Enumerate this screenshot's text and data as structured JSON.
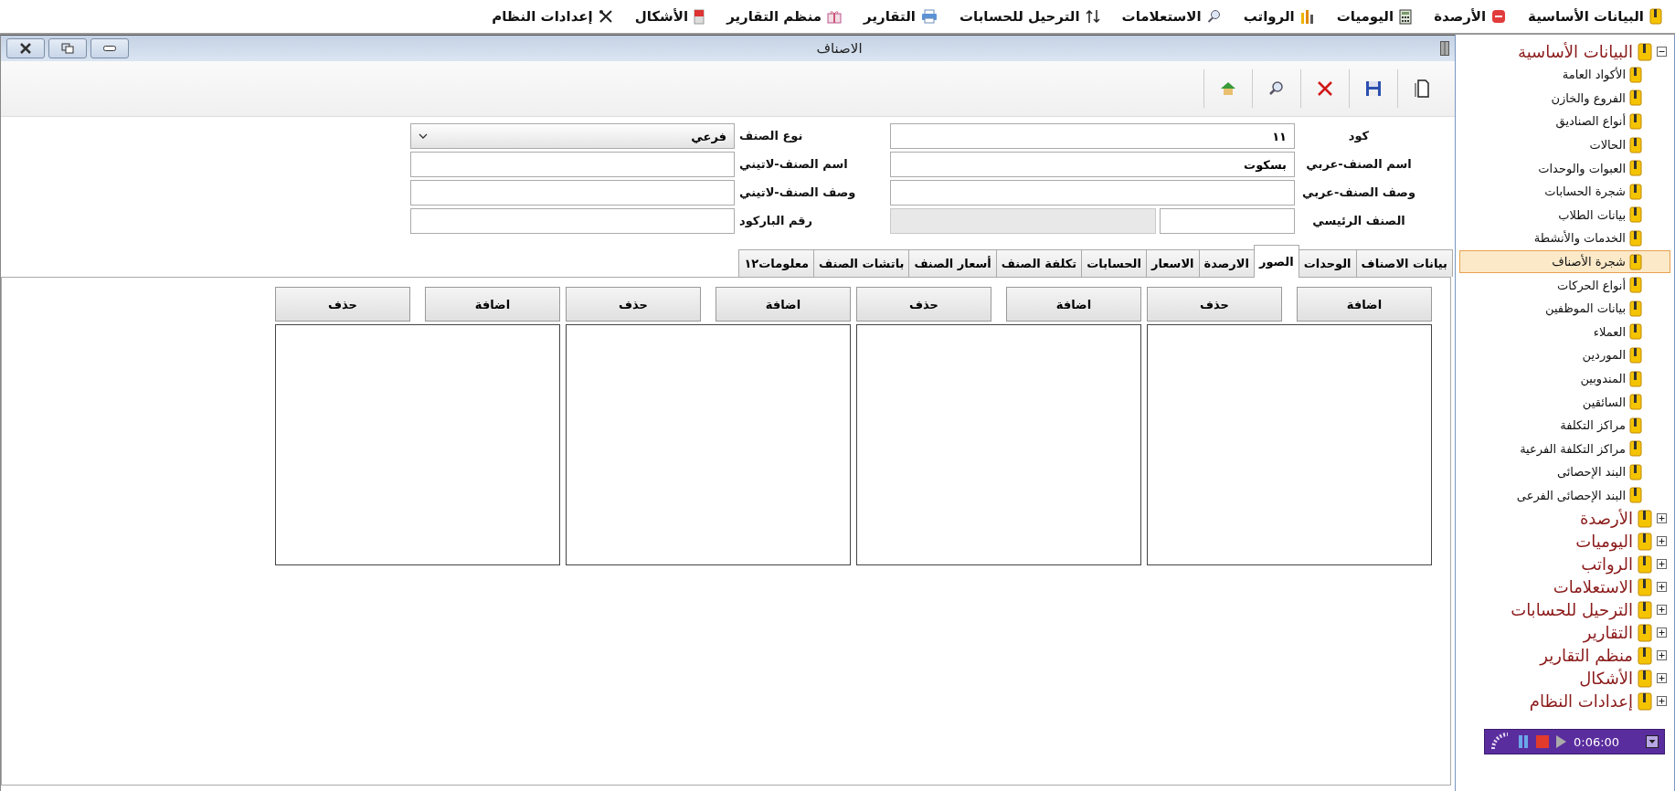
{
  "menu": [
    {
      "label": "البيانات الأساسية"
    },
    {
      "label": "الأرصدة"
    },
    {
      "label": "اليوميات"
    },
    {
      "label": "الرواتب"
    },
    {
      "label": "الاستعلامات"
    },
    {
      "label": "الترحيل للحسابات"
    },
    {
      "label": "التقارير"
    },
    {
      "label": "منظم التقارير"
    },
    {
      "label": "الأشكال"
    },
    {
      "label": "إعدادات النظام"
    }
  ],
  "window": {
    "title": "الاصناف"
  },
  "form": {
    "fields": [
      {
        "kind": "text",
        "label": "كود",
        "value": "١١"
      },
      {
        "kind": "select",
        "label": "نوع الصنف",
        "value": "فرعي"
      },
      {
        "kind": "text",
        "label": "اسم الصنف-عربي",
        "value": "بسكوت"
      },
      {
        "kind": "text",
        "label": "اسم الصنف-لاتيني"
      },
      {
        "kind": "text",
        "label": "وصف الصنف-عربي"
      },
      {
        "kind": "text",
        "label": "وصف الصنف-لاتيني"
      },
      {
        "kind": "split",
        "label": "الصنف الرئيسي",
        "inputs": [
          {
            "disabled": false
          },
          {
            "disabled": true
          }
        ]
      },
      {
        "kind": "text",
        "label": "رقم الباركود"
      }
    ]
  },
  "tabs": [
    {
      "label": "بيانات الاصناف",
      "selected": false
    },
    {
      "label": "الوحدات",
      "selected": false
    },
    {
      "label": "الصور",
      "selected": true
    },
    {
      "label": "الارصدة",
      "selected": false
    },
    {
      "label": "الاسعار",
      "selected": false
    },
    {
      "label": "الحسابات",
      "selected": false
    },
    {
      "label": "تكلفة الصنف",
      "selected": false
    },
    {
      "label": "أسعار الصنف",
      "selected": false
    },
    {
      "label": "باتشات الصنف",
      "selected": false
    },
    {
      "label": "معلومات١٢",
      "selected": false
    }
  ],
  "image_panels": [
    {
      "buttons": [
        "اضافة",
        "حذف"
      ]
    },
    {
      "buttons": [
        "اضافة",
        "حذف"
      ]
    },
    {
      "buttons": [
        "اضافة",
        "حذف"
      ]
    },
    {
      "buttons": [
        "اضافة",
        "حذف"
      ]
    }
  ],
  "tree": [
    {
      "label": "البيانات الأساسية",
      "expanded": true,
      "children": [
        {
          "label": "الأكواد العامة",
          "selected": false
        },
        {
          "label": "الفروع والخازن",
          "selected": false
        },
        {
          "label": "أنواع الصناديق",
          "selected": false
        },
        {
          "label": "الحالات",
          "selected": false
        },
        {
          "label": "العبوات والوحدات",
          "selected": false
        },
        {
          "label": "شجرة الحسابات",
          "selected": false
        },
        {
          "label": "بيانات الطلاب",
          "selected": false
        },
        {
          "label": "الخدمات والأنشطة",
          "selected": false
        },
        {
          "label": "شجرة الأصناف",
          "selected": true
        },
        {
          "label": "أنواع الحركات",
          "selected": false
        },
        {
          "label": "بيانات الموظفين",
          "selected": false
        },
        {
          "label": "العملاء",
          "selected": false
        },
        {
          "label": "الموردين",
          "selected": false
        },
        {
          "label": "المندوبين",
          "selected": false
        },
        {
          "label": "السائقين",
          "selected": false
        },
        {
          "label": "مراكز التكلفة",
          "selected": false
        },
        {
          "label": "مراكز التكلفة الفرعية",
          "selected": false
        },
        {
          "label": "البند الإحصائى",
          "selected": false
        },
        {
          "label": "البند الإحصائى الفرعى",
          "selected": false
        }
      ]
    },
    {
      "label": "الأرصدة",
      "expanded": false
    },
    {
      "label": "اليوميات",
      "expanded": false
    },
    {
      "label": "الرواتب",
      "expanded": false
    },
    {
      "label": "الاستعلامات",
      "expanded": false
    },
    {
      "label": "الترحيل للحسابات",
      "expanded": false
    },
    {
      "label": "التقارير",
      "expanded": false
    },
    {
      "label": "منظم التقارير",
      "expanded": false
    },
    {
      "label": "الأشكال",
      "expanded": false
    },
    {
      "label": "إعدادات النظام",
      "expanded": false
    }
  ],
  "recorder": {
    "time": "0:06:00"
  }
}
